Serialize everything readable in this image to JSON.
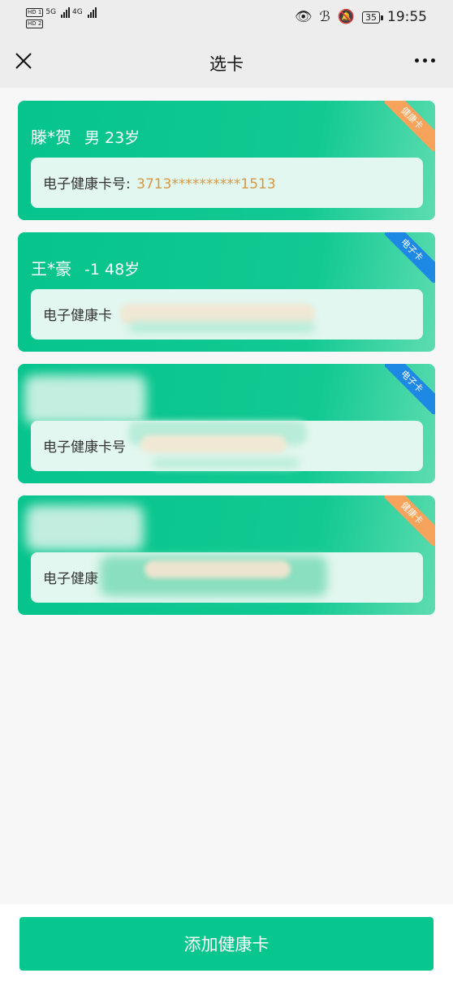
{
  "status_bar": {
    "sim_labels": [
      "HD 1",
      "HD 2"
    ],
    "network": [
      "5G",
      "4G"
    ],
    "battery": "35",
    "time": "19:55",
    "icons": [
      "eye-icon",
      "bluetooth-icon",
      "mute-icon"
    ]
  },
  "navbar": {
    "title": "选卡",
    "close_icon": "close-icon",
    "more_icon": "more-icon"
  },
  "cards": [
    {
      "name": "滕*贺",
      "gender_age": "男 23岁",
      "label": "电子健康卡号:",
      "number": "3713**********1513",
      "ribbon": "健康卡",
      "ribbon_color": "#f7a35c"
    },
    {
      "name": "王*豪",
      "gender_age": "-1 48岁",
      "label": "电子健康卡",
      "number": "",
      "ribbon": "电子卡",
      "ribbon_color": "#1e88e5"
    },
    {
      "name": "",
      "gender_age": "",
      "label": "电子健康卡号",
      "number": "",
      "ribbon": "电子卡",
      "ribbon_color": "#1e88e5"
    },
    {
      "name": "",
      "gender_age": "",
      "label": "电子健康",
      "number": "",
      "ribbon": "健康卡",
      "ribbon_color": "#f7a35c"
    }
  ],
  "bottom": {
    "add_button": "添加健康卡"
  },
  "colors": {
    "accent": "#07c78e",
    "card_number": "#d59845"
  }
}
